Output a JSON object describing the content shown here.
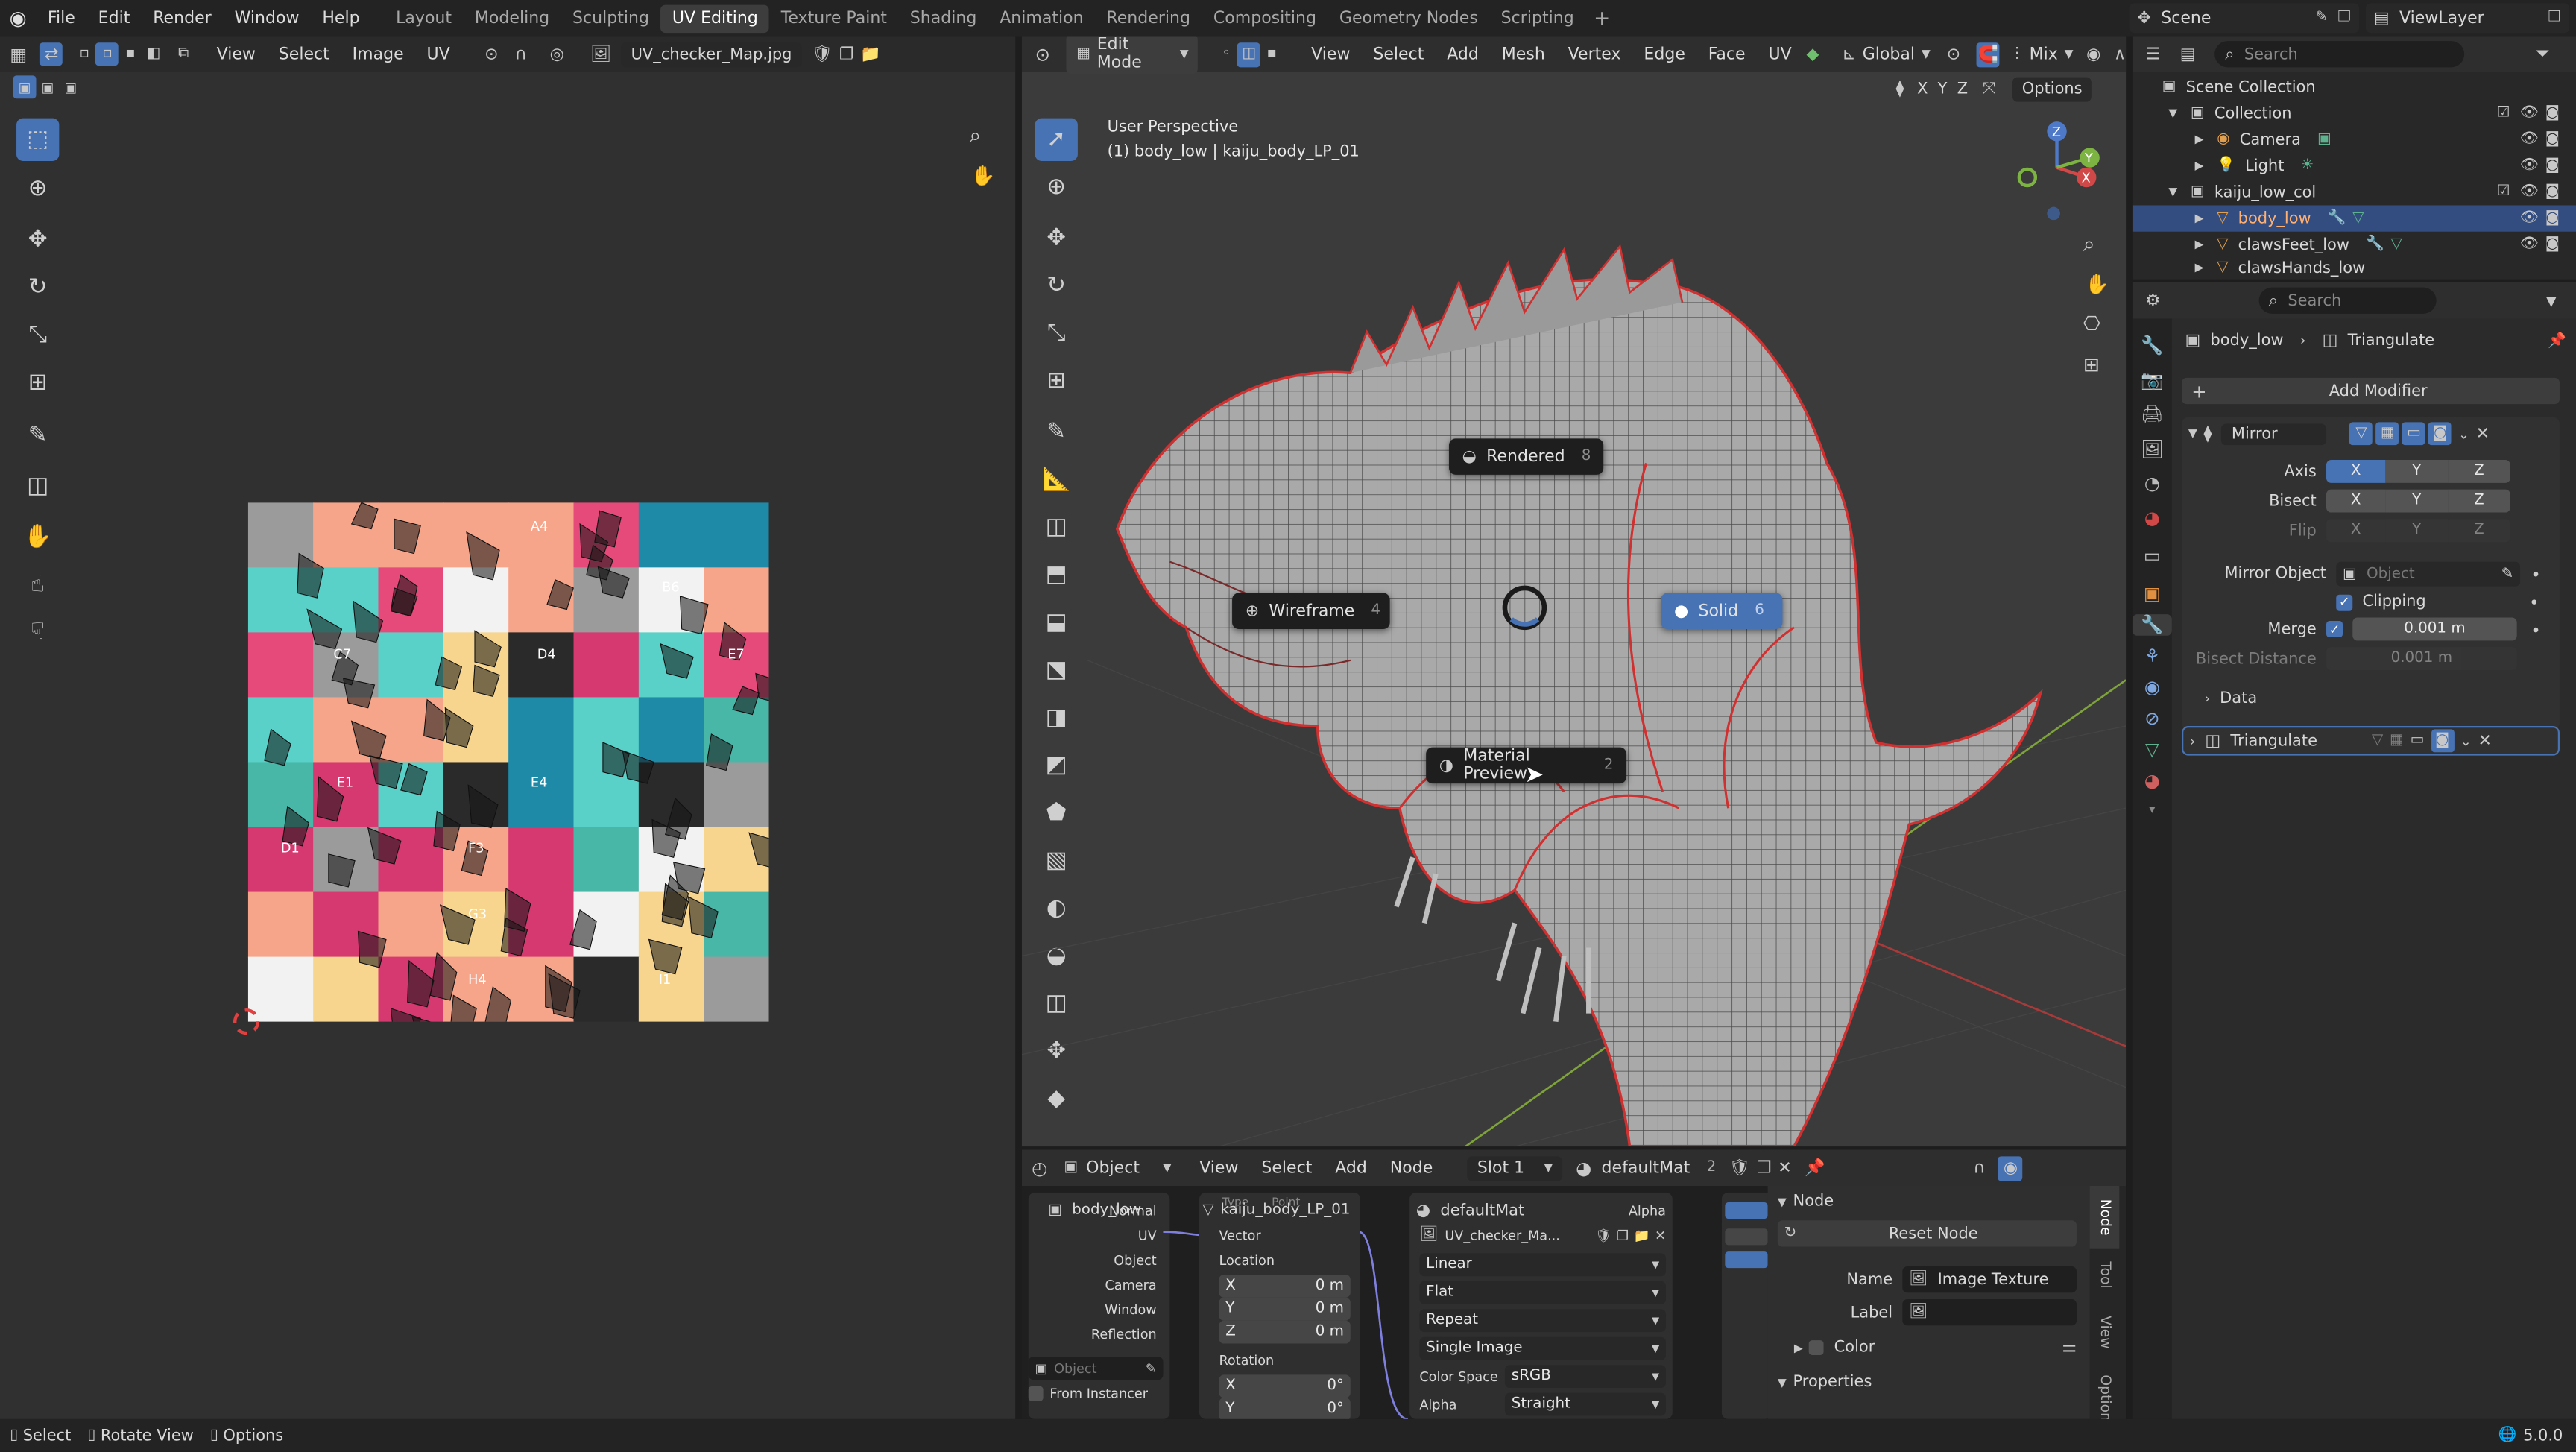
{
  "topbar": {
    "menus": [
      "File",
      "Edit",
      "Render",
      "Window",
      "Help"
    ],
    "workspaces": [
      "Layout",
      "Modeling",
      "Sculpting",
      "UV Editing",
      "Texture Paint",
      "Shading",
      "Animation",
      "Rendering",
      "Compositing",
      "Geometry Nodes",
      "Scripting"
    ],
    "active_workspace": "UV Editing",
    "add": "+",
    "scene": "Scene",
    "viewlayer": "ViewLayer"
  },
  "uv_editor": {
    "menus": [
      "View",
      "Select",
      "Image",
      "UV"
    ],
    "image_name": "UV_checker_Map.jpg",
    "grid_labels": [
      "A4",
      "B6",
      "C7",
      "D4",
      "E1",
      "E4",
      "F3",
      "G3",
      "H4",
      "I1",
      "E7",
      "D1"
    ]
  },
  "viewport": {
    "mode": "Edit Mode",
    "menus": [
      "View",
      "Select",
      "Add",
      "Mesh",
      "Vertex",
      "Edge",
      "Face",
      "UV"
    ],
    "transform": "Global",
    "shading": "Mix",
    "axes": [
      "X",
      "Y",
      "Z"
    ],
    "options": "Options",
    "overlay_title": "User Perspective",
    "overlay_subtitle": "(1) body_low | kaiju_body_LP_01",
    "pie": {
      "rendered": "Rendered",
      "rendered_key": "8",
      "wireframe": "Wireframe",
      "wireframe_key": "4",
      "solid": "Solid",
      "solid_key": "6",
      "material": "Material Preview",
      "material_key": "2"
    }
  },
  "node_editor": {
    "type": "Object",
    "menus": [
      "View",
      "Select",
      "Add",
      "Node"
    ],
    "slot": "Slot 1",
    "material": "defaultMat",
    "users": "2",
    "texcoord": {
      "object": "body_low",
      "outputs": [
        "Normal",
        "UV",
        "Object",
        "Camera",
        "Window",
        "Reflection"
      ],
      "object_label": "Object",
      "from_instancer": "From Instancer"
    },
    "mapping": {
      "name": "kaiju_body_LP_01",
      "type_label": "Type",
      "point": "Point",
      "vector": "Vector",
      "location": "Location",
      "loc_x": "0 m",
      "loc_y": "0 m",
      "loc_z": "0 m",
      "rotation": "Rotation",
      "rot_x": "0°",
      "rot_y": "0°"
    },
    "image": {
      "material": "defaultMat",
      "image": "UV_checker_Ma...",
      "alpha": "Alpha",
      "interp": "Linear",
      "proj": "Flat",
      "ext": "Repeat",
      "source": "Single Image",
      "cs_label": "Color Space",
      "cs": "sRGB",
      "alpha_label": "Alpha",
      "alpha_mode": "Straight"
    },
    "panel": {
      "node": "Node",
      "reset": "Reset Node",
      "name_label": "Name",
      "name": "Image Texture",
      "label_label": "Label",
      "color": "Color",
      "properties": "Properties",
      "tabs": [
        "Node",
        "Tool",
        "View",
        "Options"
      ]
    }
  },
  "outliner": {
    "search": "Search",
    "root": "Scene Collection",
    "items": [
      {
        "name": "Collection",
        "depth": 1
      },
      {
        "name": "Camera",
        "depth": 2
      },
      {
        "name": "Light",
        "depth": 2
      },
      {
        "name": "kaiju_low_col",
        "depth": 1
      },
      {
        "name": "body_low",
        "depth": 2
      },
      {
        "name": "clawsFeet_low",
        "depth": 2
      },
      {
        "name": "clawsHands_low",
        "depth": 2
      }
    ]
  },
  "properties": {
    "search": "Search",
    "object": "body_low",
    "modifier_crumb": "Triangulate",
    "add_modifier": "Add Modifier",
    "mirror": {
      "name": "Mirror",
      "axis": "Axis",
      "bisect": "Bisect",
      "flip": "Flip",
      "xyz": [
        "X",
        "Y",
        "Z"
      ],
      "mirror_object": "Mirror Object",
      "object_placeholder": "Object",
      "clipping": "Clipping",
      "merge": "Merge",
      "merge_val": "0.001 m",
      "bisect_distance": "Bisect Distance",
      "bisect_val": "0.001 m",
      "data": "Data"
    },
    "triangulate": "Triangulate"
  },
  "statusbar": {
    "select": "Select",
    "rotate": "Rotate View",
    "options": "Options",
    "version": "5.0.0"
  },
  "colors": {
    "accent": "#4772b3",
    "bg": "#1d1d1d",
    "header": "#303030",
    "edge_red": "#d03030"
  }
}
